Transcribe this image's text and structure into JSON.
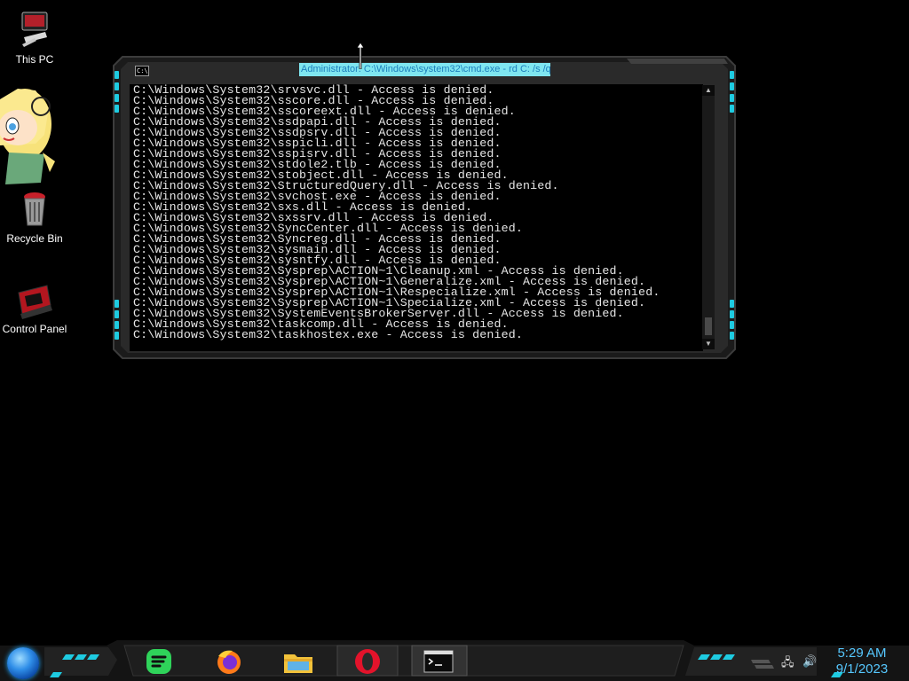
{
  "desktop": {
    "icons": [
      {
        "label": "This PC",
        "icon": "this-pc-icon"
      },
      {
        "label": "Recycle Bin",
        "icon": "recycle-bin-icon"
      },
      {
        "label": "Control Panel",
        "icon": "control-panel-icon"
      }
    ]
  },
  "console": {
    "title": "Administrator: C:\\Windows\\system32\\cmd.exe - rd  C:  /s /q",
    "icon_text": "C:\\",
    "lines": [
      "C:\\Windows\\System32\\srvsvc.dll - Access is denied.",
      "C:\\Windows\\System32\\sscore.dll - Access is denied.",
      "C:\\Windows\\System32\\sscoreext.dll - Access is denied.",
      "C:\\Windows\\System32\\ssdpapi.dll - Access is denied.",
      "C:\\Windows\\System32\\ssdpsrv.dll - Access is denied.",
      "C:\\Windows\\System32\\sspicli.dll - Access is denied.",
      "C:\\Windows\\System32\\sspisrv.dll - Access is denied.",
      "C:\\Windows\\System32\\stdole2.tlb - Access is denied.",
      "C:\\Windows\\System32\\stobject.dll - Access is denied.",
      "C:\\Windows\\System32\\StructuredQuery.dll - Access is denied.",
      "C:\\Windows\\System32\\svchost.exe - Access is denied.",
      "C:\\Windows\\System32\\sxs.dll - Access is denied.",
      "C:\\Windows\\System32\\sxssrv.dll - Access is denied.",
      "C:\\Windows\\System32\\SyncCenter.dll - Access is denied.",
      "C:\\Windows\\System32\\Syncreg.dll - Access is denied.",
      "C:\\Windows\\System32\\sysmain.dll - Access is denied.",
      "C:\\Windows\\System32\\sysntfy.dll - Access is denied.",
      "C:\\Windows\\System32\\Sysprep\\ACTION~1\\Cleanup.xml - Access is denied.",
      "C:\\Windows\\System32\\Sysprep\\ACTION~1\\Generalize.xml - Access is denied.",
      "C:\\Windows\\System32\\Sysprep\\ACTION~1\\Respecialize.xml - Access is denied.",
      "C:\\Windows\\System32\\Sysprep\\ACTION~1\\Specialize.xml - Access is denied.",
      "C:\\Windows\\System32\\SystemEventsBrokerServer.dll - Access is denied.",
      "C:\\Windows\\System32\\taskcomp.dll - Access is denied.",
      "C:\\Windows\\System32\\taskhostex.exe - Access is denied."
    ]
  },
  "taskbar": {
    "apps": [
      {
        "name": "spotify-icon"
      },
      {
        "name": "firefox-icon"
      },
      {
        "name": "file-explorer-icon"
      },
      {
        "name": "opera-icon"
      },
      {
        "name": "command-prompt-icon",
        "active": true
      }
    ],
    "clock": {
      "time": "5:29 AM",
      "date": "9/1/2023"
    }
  },
  "colors": {
    "accent": "#1ecbe1",
    "clock": "#56c8ff",
    "title_bg": "#7fe6f0"
  }
}
